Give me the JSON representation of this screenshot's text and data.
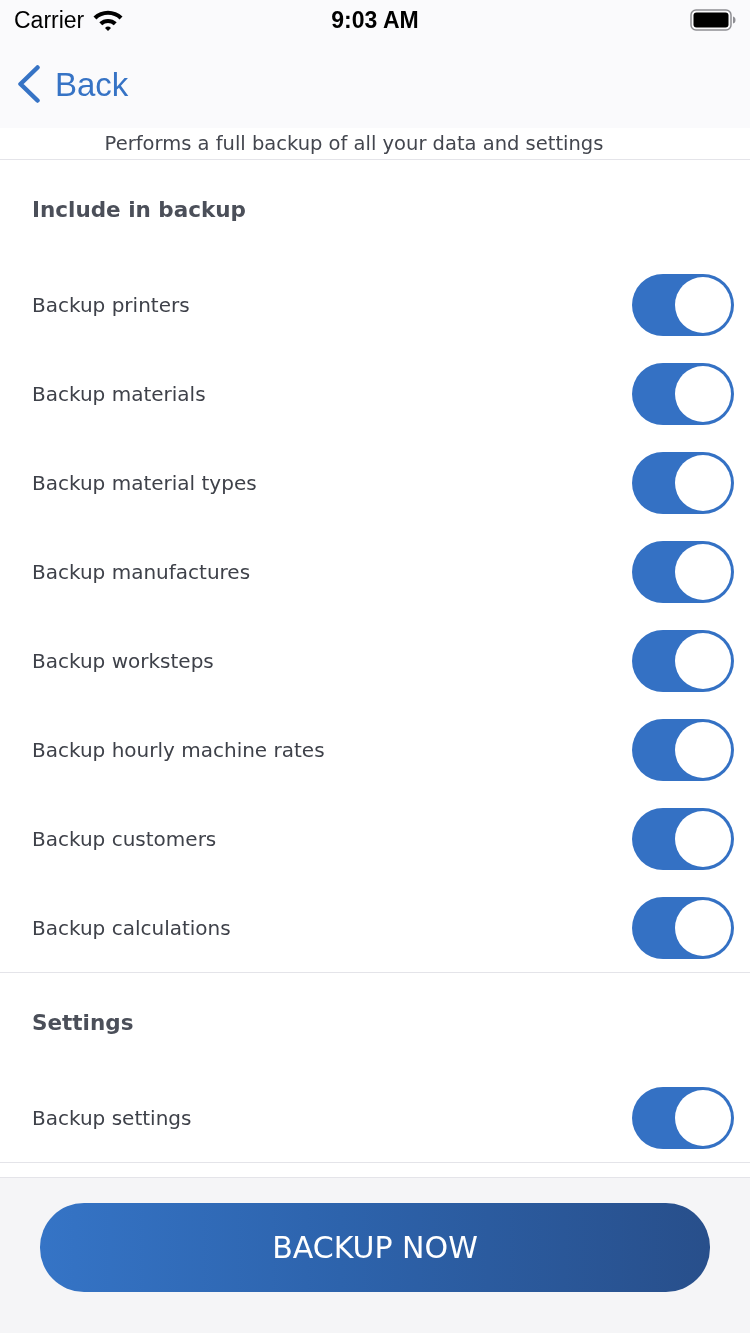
{
  "status_bar": {
    "carrier": "Carrier",
    "time": "9:03 AM"
  },
  "nav": {
    "back_label": "Back"
  },
  "description": "Performs a full backup of all your data and settings",
  "sections": [
    {
      "title": "Include in backup",
      "items": [
        {
          "label": "Backup printers",
          "on": true
        },
        {
          "label": "Backup materials",
          "on": true
        },
        {
          "label": "Backup material types",
          "on": true
        },
        {
          "label": "Backup manufactures",
          "on": true
        },
        {
          "label": "Backup worksteps",
          "on": true
        },
        {
          "label": "Backup hourly machine rates",
          "on": true
        },
        {
          "label": "Backup customers",
          "on": true
        },
        {
          "label": "Backup calculations",
          "on": true
        }
      ]
    },
    {
      "title": "Settings",
      "items": [
        {
          "label": "Backup settings",
          "on": true
        }
      ]
    }
  ],
  "action_button": {
    "label": "BACKUP NOW"
  }
}
